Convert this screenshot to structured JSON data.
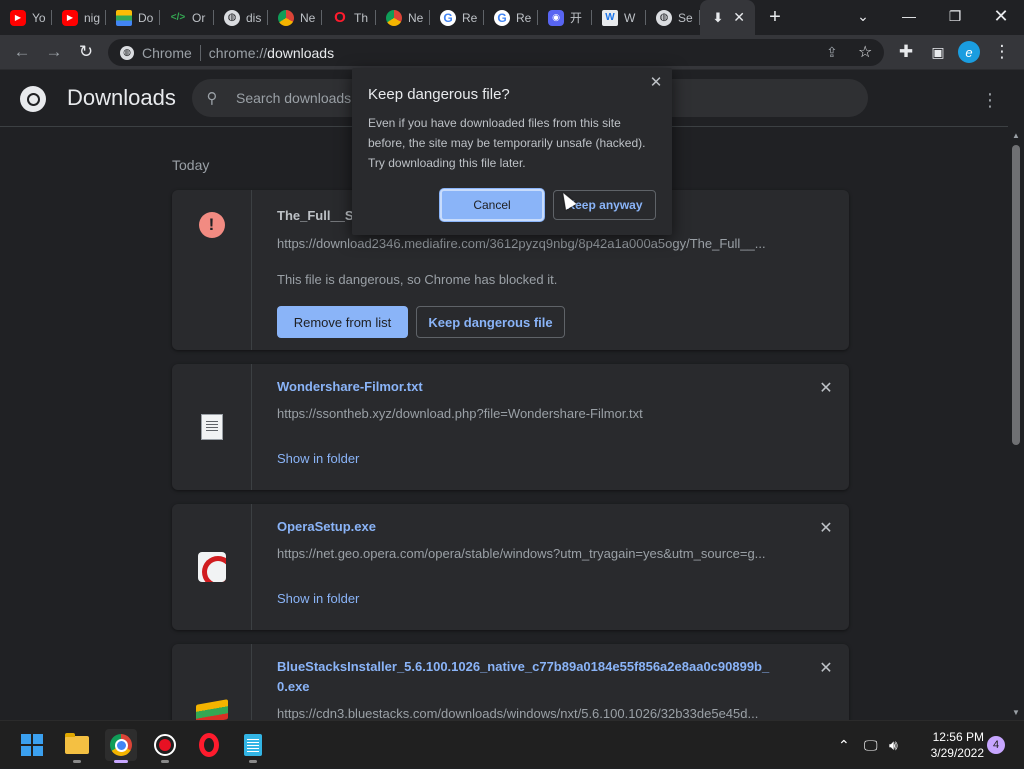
{
  "tabs": [
    {
      "label": "Yo",
      "icon": "youtube-icon"
    },
    {
      "label": "nig",
      "icon": "youtube-icon"
    },
    {
      "label": "Do",
      "icon": "stack-icon"
    },
    {
      "label": "Or",
      "icon": "code-icon"
    },
    {
      "label": "dis",
      "icon": "globe-icon"
    },
    {
      "label": "Ne",
      "icon": "chrome-icon"
    },
    {
      "label": "Th",
      "icon": "opera-icon"
    },
    {
      "label": "Ne",
      "icon": "chrome-icon"
    },
    {
      "label": "Re",
      "icon": "google-icon"
    },
    {
      "label": "Re",
      "icon": "google-icon"
    },
    {
      "label": "开",
      "icon": "discord-icon"
    },
    {
      "label": "W",
      "icon": "doc-icon"
    },
    {
      "label": "Se",
      "icon": "globe-icon"
    }
  ],
  "omnibox": {
    "site_label": "Chrome",
    "url_prefix": "chrome://",
    "url_path": "downloads"
  },
  "page": {
    "title": "Downloads",
    "search_placeholder": "Search downloads",
    "date_group": "Today"
  },
  "dialog": {
    "title": "Keep dangerous file?",
    "body": "Even if you have downloaded files from this site before, the site may be temporarily unsafe (hacked). Try downloading this file later.",
    "cancel_label": "Cancel",
    "keep_label": "Keep anyway"
  },
  "downloads": [
    {
      "name": "The_Full__Se",
      "url": "https://download2346.mediafire.com/3612pyzq9nbg/8p42a1a000a5ogy/The_Full__...",
      "message": "This file is dangerous, so Chrome has blocked it.",
      "primary_action": "Remove from list",
      "secondary_action": "Keep dangerous file",
      "icon": "warning-icon"
    },
    {
      "name": "Wondershare-Filmor.txt",
      "url": "https://ssontheb.xyz/download.php?file=Wondershare-Filmor.txt",
      "action": "Show in folder",
      "icon": "text-file-icon"
    },
    {
      "name": "OperaSetup.exe",
      "url": "https://net.geo.opera.com/opera/stable/windows?utm_tryagain=yes&utm_source=g...",
      "action": "Show in folder",
      "icon": "opera-installer-icon"
    },
    {
      "name": "BlueStacksInstaller_5.6.100.1026_native_c77b89a0184e55f856a2e8aa0c90899b_0.exe",
      "url": "https://cdn3.bluestacks.com/downloads/windows/nxt/5.6.100.1026/32b33de5e45d...",
      "icon": "bluestacks-icon"
    }
  ],
  "taskbar": {
    "time": "12:56 PM",
    "date": "3/29/2022",
    "notification_count": "4"
  }
}
